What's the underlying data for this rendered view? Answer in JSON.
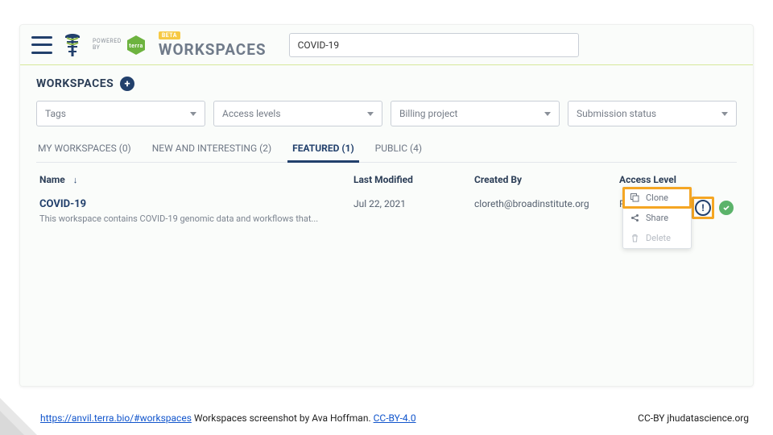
{
  "header": {
    "powered_prefix": "POWERED",
    "powered_by": "BY",
    "terra_label": "terra",
    "beta": "BETA",
    "brand": "WORKSPACES",
    "search_value": "COVID-19"
  },
  "section": {
    "title": "WORKSPACES"
  },
  "filters": [
    {
      "label": "Tags"
    },
    {
      "label": "Access levels"
    },
    {
      "label": "Billing project"
    },
    {
      "label": "Submission status"
    }
  ],
  "tabs": [
    {
      "label": "MY WORKSPACES (0)",
      "active": false
    },
    {
      "label": "NEW AND INTERESTING (2)",
      "active": false
    },
    {
      "label": "FEATURED (1)",
      "active": true
    },
    {
      "label": "PUBLIC (4)",
      "active": false
    }
  ],
  "columns": {
    "name": "Name",
    "modified": "Last Modified",
    "created": "Created By",
    "access": "Access Level"
  },
  "rows": [
    {
      "name": "COVID-19",
      "desc": "This workspace contains COVID-19 genomic data and workflows that...",
      "modified": "Jul 22, 2021",
      "created_by": "cloreth@broadinstitute.org",
      "access": "Reader"
    }
  ],
  "popup": {
    "clone": "Clone",
    "share": "Share",
    "delete": "Delete"
  },
  "footer": {
    "url_text": "https://anvil.terra.bio/#workspaces",
    "mid": " Workspaces screenshot by Ava Hoffman.  ",
    "license": "CC-BY-4.0",
    "right": "CC-BY  jhudatascience.org"
  }
}
